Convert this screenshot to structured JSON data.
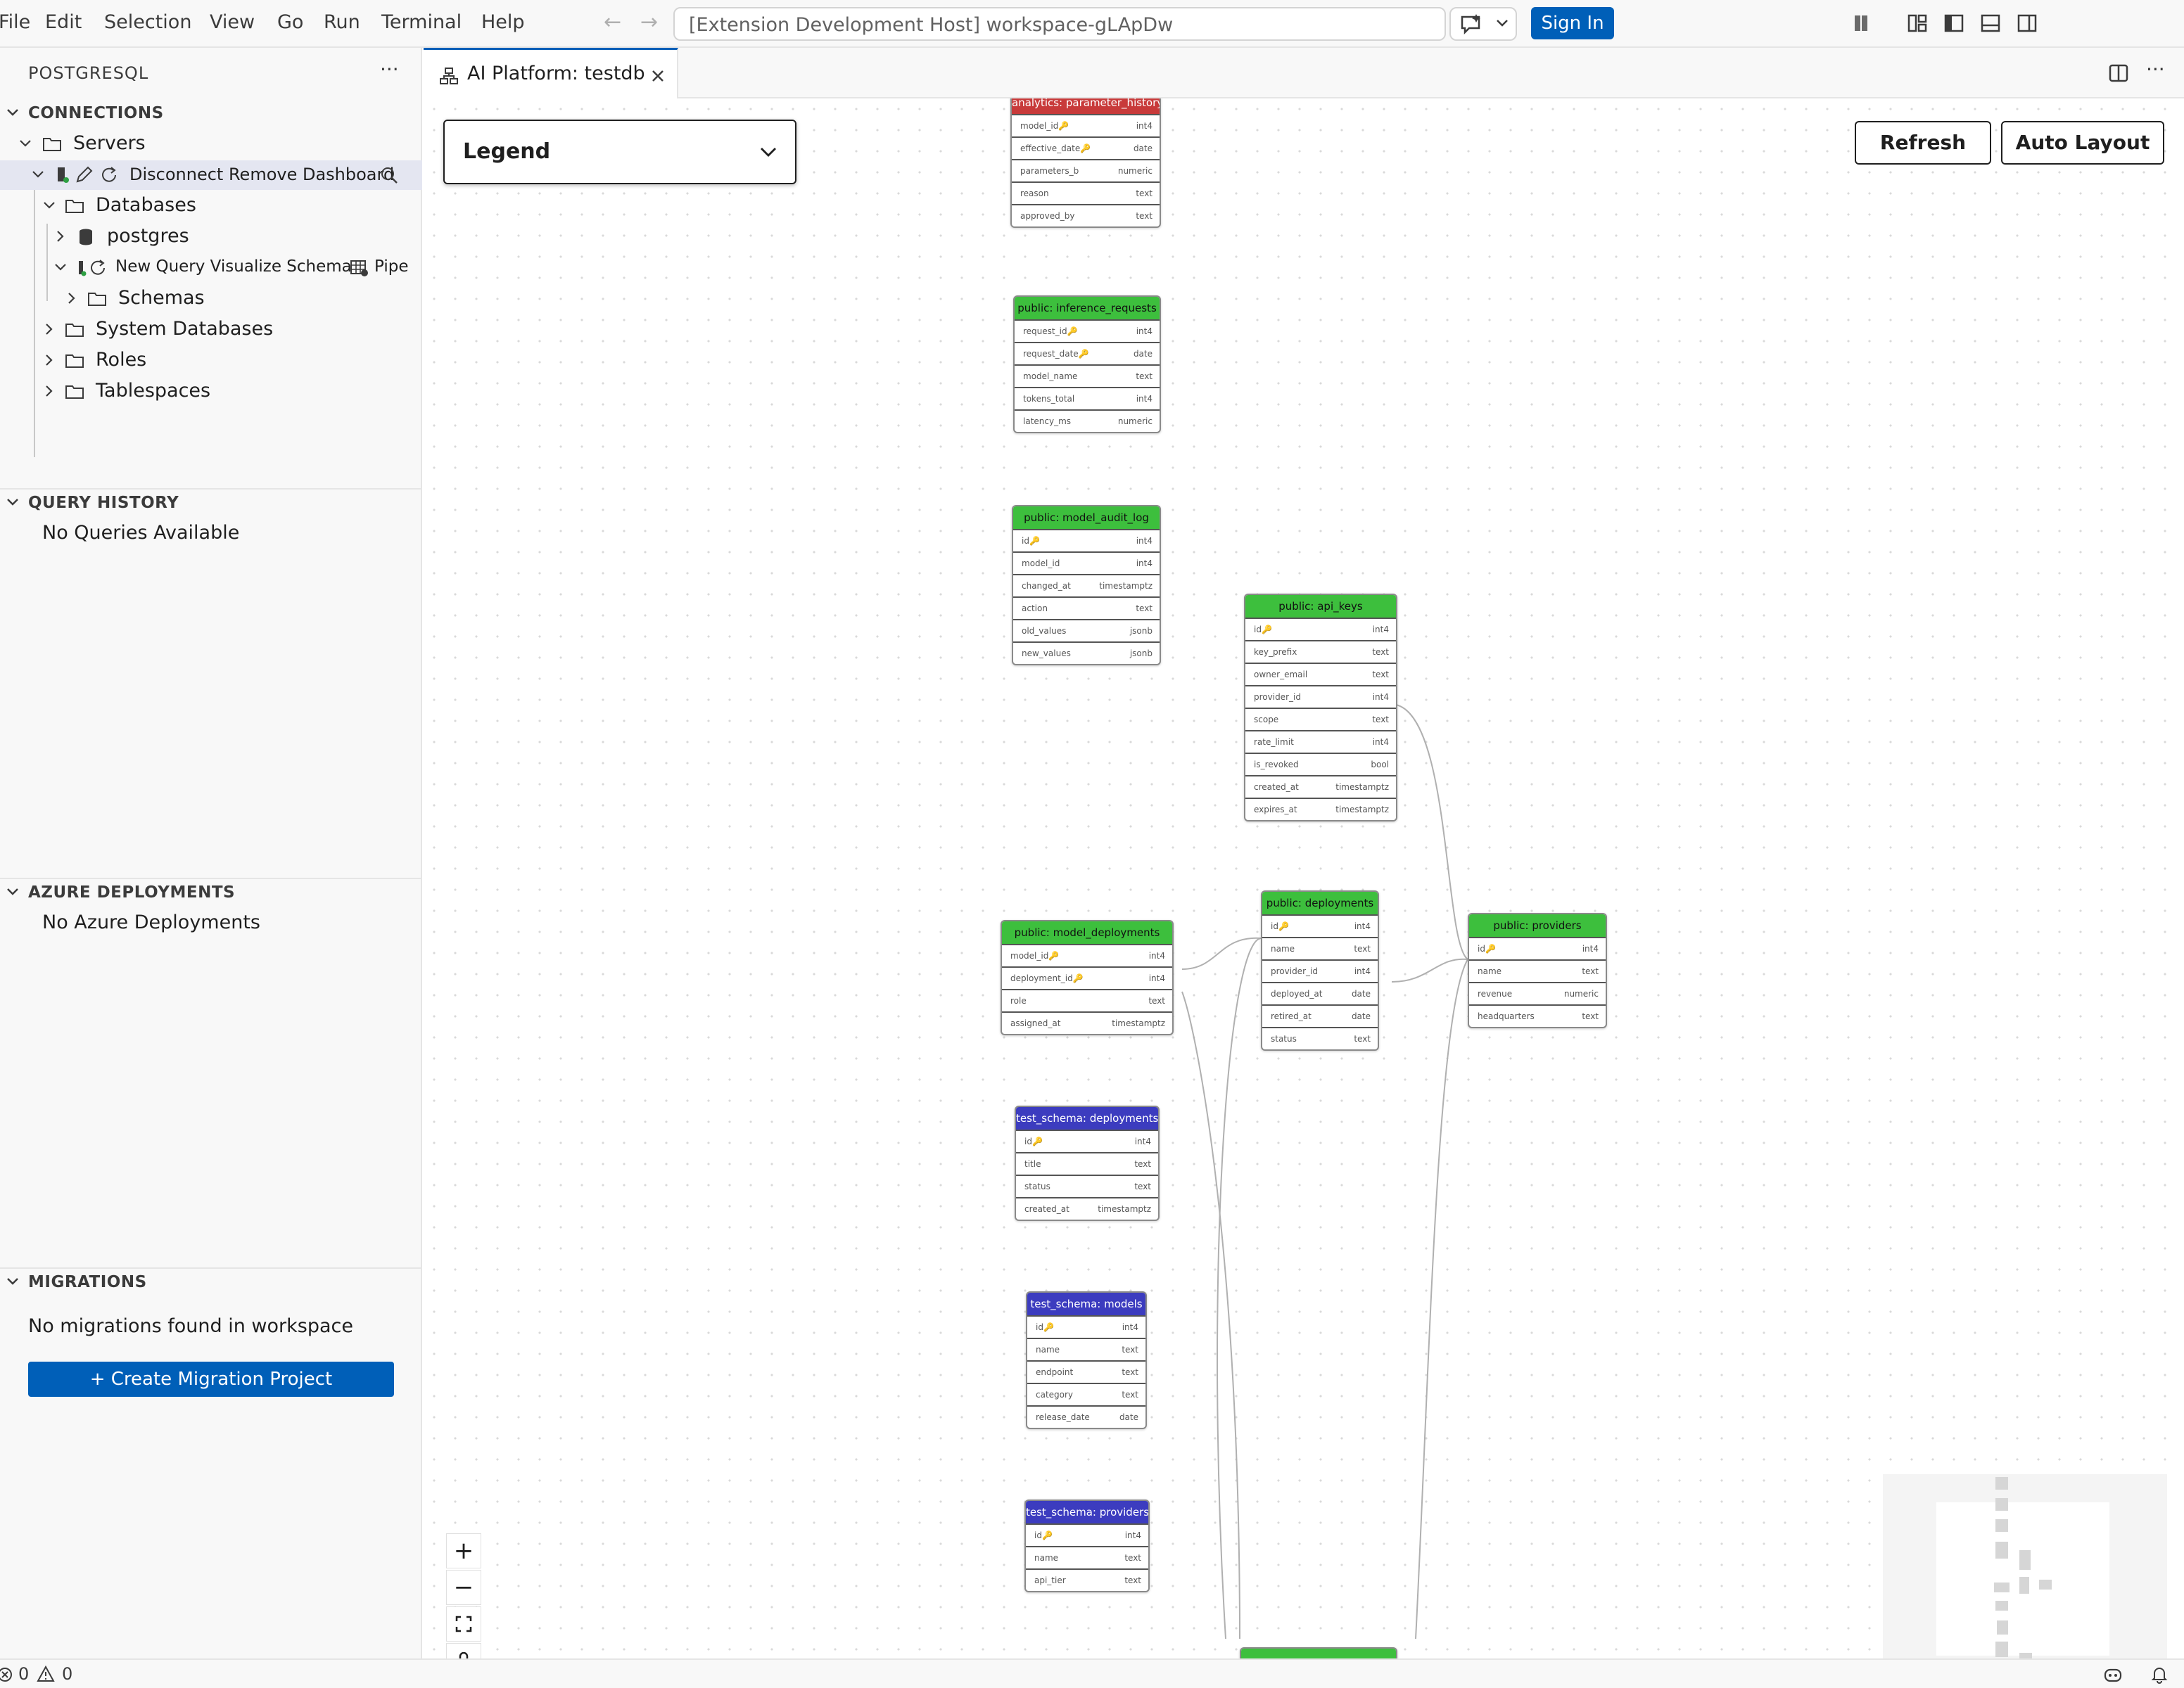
{
  "menu": [
    "File",
    "Edit",
    "Selection",
    "View",
    "Go",
    "Run",
    "Terminal",
    "Help"
  ],
  "command_center": {
    "text": "[Extension Development Host] workspace-gLApDw"
  },
  "sign_in_label": "Sign In",
  "sidebar": {
    "title": "POSTGRESQL",
    "more": "···",
    "connections": {
      "header": "CONNECTIONS",
      "servers": "Servers",
      "server_actions": "Disconnect Remove Dashboard",
      "databases": "Databases",
      "postgres": "postgres",
      "db_actions": "New Query Visualize Schema",
      "db_actions_extra": "Pipe",
      "schemas": "Schemas",
      "system_databases": "System Databases",
      "roles": "Roles",
      "tablespaces": "Tablespaces"
    },
    "query_history": {
      "header": "QUERY HISTORY",
      "empty": "No Queries Available"
    },
    "azure": {
      "header": "AZURE DEPLOYMENTS",
      "empty": "No Azure Deployments"
    },
    "migrations": {
      "header": "MIGRATIONS",
      "empty": "No migrations found in workspace",
      "button": "+ Create Migration Project"
    }
  },
  "editor": {
    "tab_label": "AI Platform: testdb",
    "legend_title": "Legend",
    "refresh": "Refresh",
    "auto_layout": "Auto Layout"
  },
  "colors": {
    "accent": "#005fb8",
    "public_table": "#3dbf3d",
    "analytics_table": "#c83a3a",
    "test_schema_table": "#3c3cbf"
  },
  "tables": {
    "parameter_history": {
      "title": "analytics: parameter_history",
      "rows": [
        {
          "name": "model_id",
          "type": "int4",
          "key": true
        },
        {
          "name": "effective_date",
          "type": "date",
          "key": true
        },
        {
          "name": "parameters_b",
          "type": "numeric"
        },
        {
          "name": "reason",
          "type": "text"
        },
        {
          "name": "approved_by",
          "type": "text"
        }
      ]
    },
    "inference_requests": {
      "title": "public: inference_requests",
      "rows": [
        {
          "name": "request_id",
          "type": "int4",
          "key": true
        },
        {
          "name": "request_date",
          "type": "date",
          "key": true
        },
        {
          "name": "model_name",
          "type": "text"
        },
        {
          "name": "tokens_total",
          "type": "int4"
        },
        {
          "name": "latency_ms",
          "type": "numeric"
        }
      ]
    },
    "model_audit_log": {
      "title": "public: model_audit_log",
      "rows": [
        {
          "name": "id",
          "type": "int4",
          "key": true
        },
        {
          "name": "model_id",
          "type": "int4"
        },
        {
          "name": "changed_at",
          "type": "timestamptz"
        },
        {
          "name": "action",
          "type": "text"
        },
        {
          "name": "old_values",
          "type": "jsonb"
        },
        {
          "name": "new_values",
          "type": "jsonb"
        }
      ]
    },
    "api_keys": {
      "title": "public: api_keys",
      "rows": [
        {
          "name": "id",
          "type": "int4",
          "key": true
        },
        {
          "name": "key_prefix",
          "type": "text"
        },
        {
          "name": "owner_email",
          "type": "text"
        },
        {
          "name": "provider_id",
          "type": "int4"
        },
        {
          "name": "scope",
          "type": "text"
        },
        {
          "name": "rate_limit",
          "type": "int4"
        },
        {
          "name": "is_revoked",
          "type": "bool"
        },
        {
          "name": "created_at",
          "type": "timestamptz"
        },
        {
          "name": "expires_at",
          "type": "timestamptz"
        }
      ]
    },
    "model_deployments": {
      "title": "public: model_deployments",
      "rows": [
        {
          "name": "model_id",
          "type": "int4",
          "key": true
        },
        {
          "name": "deployment_id",
          "type": "int4",
          "key": true
        },
        {
          "name": "role",
          "type": "text"
        },
        {
          "name": "assigned_at",
          "type": "timestamptz"
        }
      ]
    },
    "deployments": {
      "title": "public: deployments",
      "rows": [
        {
          "name": "id",
          "type": "int4",
          "key": true
        },
        {
          "name": "name",
          "type": "text"
        },
        {
          "name": "provider_id",
          "type": "int4"
        },
        {
          "name": "deployed_at",
          "type": "date"
        },
        {
          "name": "retired_at",
          "type": "date"
        },
        {
          "name": "status",
          "type": "text"
        }
      ]
    },
    "providers": {
      "title": "public: providers",
      "rows": [
        {
          "name": "id",
          "type": "int4",
          "key": true
        },
        {
          "name": "name",
          "type": "text"
        },
        {
          "name": "revenue",
          "type": "numeric"
        },
        {
          "name": "headquarters",
          "type": "text"
        }
      ]
    },
    "ts_deployments": {
      "title": "test_schema: deployments",
      "rows": [
        {
          "name": "id",
          "type": "int4",
          "key": true
        },
        {
          "name": "title",
          "type": "text"
        },
        {
          "name": "status",
          "type": "text"
        },
        {
          "name": "created_at",
          "type": "timestamptz"
        }
      ]
    },
    "ts_models": {
      "title": "test_schema: models",
      "rows": [
        {
          "name": "id",
          "type": "int4",
          "key": true
        },
        {
          "name": "name",
          "type": "text"
        },
        {
          "name": "endpoint",
          "type": "text"
        },
        {
          "name": "category",
          "type": "text"
        },
        {
          "name": "release_date",
          "type": "date"
        }
      ]
    },
    "ts_providers": {
      "title": "test_schema: providers",
      "rows": [
        {
          "name": "id",
          "type": "int4",
          "key": true
        },
        {
          "name": "name",
          "type": "text"
        },
        {
          "name": "api_tier",
          "type": "text"
        }
      ]
    }
  },
  "zoom_controls": {
    "zoom_in": "+",
    "zoom_out": "−",
    "fit": "⛶",
    "lock": "🔒"
  },
  "status": {
    "errors": "0",
    "warnings": "0"
  }
}
